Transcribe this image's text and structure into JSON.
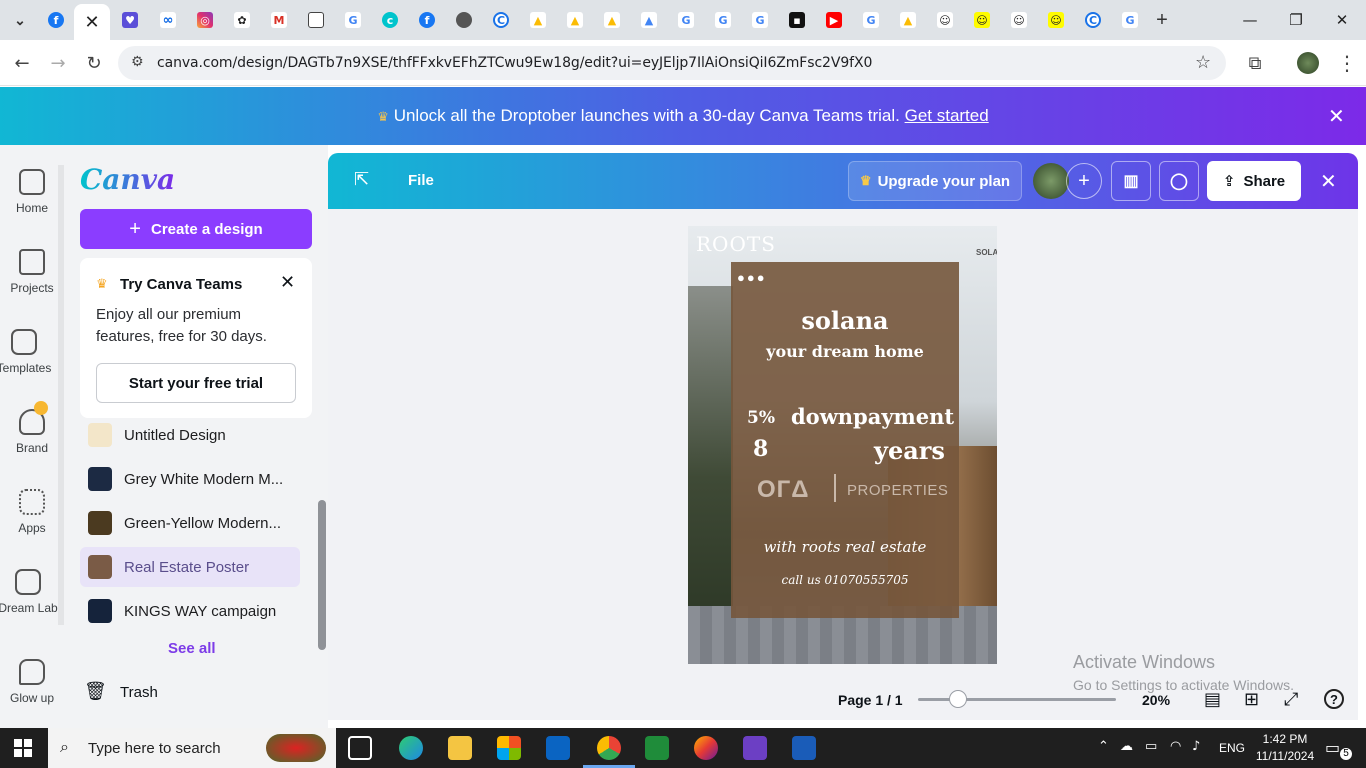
{
  "browser": {
    "url": "canva.com/design/DAGTb7n9XSE/thfFFxkvEFhZTCwu9Ew18g/edit?ui=eyJEljp7IlAiOnsiQiI6ZmFsc2V9fX0",
    "active_tab_close": "✕",
    "new_tab": "+",
    "minimize": "—",
    "restore": "❐",
    "close": "✕"
  },
  "promo": {
    "text": "Unlock all the Droptober launches with a 30-day Canva Teams trial.",
    "link": "Get started",
    "crown": "♛",
    "close": "✕"
  },
  "rail": {
    "items": [
      {
        "label": "Home",
        "icon": "home-icon"
      },
      {
        "label": "Projects",
        "icon": "folder-icon"
      },
      {
        "label": "Templates",
        "icon": "templates-icon"
      },
      {
        "label": "Brand",
        "icon": "brand-icon"
      },
      {
        "label": "Apps",
        "icon": "apps-icon"
      },
      {
        "label": "Dream Lab",
        "icon": "dream-lab-icon"
      },
      {
        "label": "Glow up",
        "icon": "glow-up-icon"
      }
    ]
  },
  "panel": {
    "logo": "Canva",
    "create_button": "Create a design",
    "teams_card": {
      "title": "Try Canva Teams",
      "body": "Enjoy all our premium features, free for 30 days.",
      "cta": "Start your free trial"
    },
    "recent": [
      {
        "label": "Untitled Design",
        "color": "#f3e6c9",
        "selected": false
      },
      {
        "label": "Grey White Modern M...",
        "color": "#1c2a43",
        "selected": false
      },
      {
        "label": "Green-Yellow Modern...",
        "color": "#4b3a20",
        "selected": false
      },
      {
        "label": "Real Estate Poster",
        "color": "#7a5b46",
        "selected": true
      },
      {
        "label": "KINGS WAY campaign",
        "color": "#15233b",
        "selected": false
      }
    ],
    "see_all": "See all",
    "trash": "Trash"
  },
  "editor": {
    "file_menu": "File",
    "upgrade": "Upgrade your plan",
    "share": "Share",
    "add": "+",
    "close": "✕"
  },
  "poster": {
    "brand": "ROOTS",
    "corner_text": "SOLA",
    "dots": "●●●",
    "title": "solana",
    "subtitle": "your dream home",
    "percent": "5%",
    "downpayment": "downpayment",
    "years_num": "8",
    "years": "years",
    "logo_text": "ОГΔ",
    "properties": "PROPERTIES",
    "script1": "with roots real estate",
    "script2": "call us 01070555705"
  },
  "bottom": {
    "page": "Page 1 / 1",
    "zoom": "20%",
    "zoom_level": 0.2
  },
  "watermark": {
    "line1": "Activate Windows",
    "line2": "Go to Settings to activate Windows."
  },
  "taskbar": {
    "search_placeholder": "Type here to search",
    "lang": "ENG",
    "time": "1:42 PM",
    "date": "11/11/2024",
    "notifications": "5"
  }
}
